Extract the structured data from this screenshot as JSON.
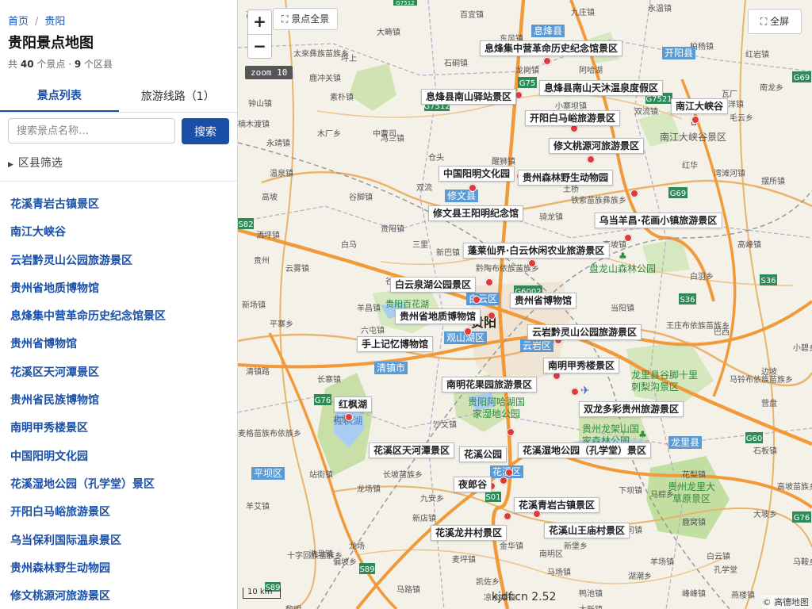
{
  "breadcrumb": {
    "home": "首页",
    "current": "贵阳"
  },
  "title": "贵阳景点地图",
  "stats": {
    "prefix": "共",
    "spot_count": "40",
    "spot_unit": "个景点 ·",
    "district_count": "9",
    "district_unit": "个区县"
  },
  "tabs": [
    {
      "label": "景点列表",
      "active": true
    },
    {
      "label": "旅游线路（1）",
      "active": false
    }
  ],
  "search": {
    "placeholder": "搜索景点名称…",
    "button": "搜索"
  },
  "filter": {
    "arrow": "▶",
    "label": "区县筛选"
  },
  "spots": [
    "花溪青岩古镇景区",
    "南江大峡谷",
    "云岩黔灵山公园旅游景区",
    "贵州省地质博物馆",
    "息烽集中营革命历史纪念馆景区",
    "贵州省博物馆",
    "花溪区天河潭景区",
    "贵州省民族博物馆",
    "南明甲秀楼景区",
    "中国阳明文化园",
    "花溪湿地公园（孔学堂）景区",
    "开阳白马峪旅游景区",
    "乌当保利国际温泉景区",
    "贵州森林野生动物园",
    "修文桃源河旅游景区"
  ],
  "map_controls": {
    "zoom_in": "+",
    "zoom_out": "−",
    "overview_icon": "⛶",
    "overview": "景点全景",
    "fullscreen_icon": "⛶",
    "fullscreen": "全屏",
    "zoom_readout": "zoom 10",
    "scale": "10 km",
    "watermark": "kjdf.cn 2.52",
    "attribution": "© 高德地图"
  },
  "map_callouts": [
    "息烽集中营革命历史纪念馆景区",
    "息烽县南山天沐温泉度假区",
    "息烽县南山驿站景区",
    "南江大峡谷",
    "开阳白马峪旅游景区",
    "修文桃源河旅游景区",
    "中国阳明文化园",
    "贵州森林野生动物园",
    "修文县王阳明纪念馆",
    "乌当羊昌·花画小镇旅游景区",
    "蓬莱仙界·白云休闲农业旅游景区",
    "白云泉湖公园景区",
    "贵州省博物馆",
    "贵州省地质博物馆",
    "云岩黔灵山公园旅游景区",
    "手上记忆博物馆",
    "南明甲秀楼景区",
    "南明花果园旅游景区",
    "双龙多彩贵州旅游景区",
    "红枫湖",
    "花溪区天河潭景区",
    "花溪公园",
    "花溪湿地公园（孔学堂）景区",
    "夜郎谷",
    "花溪青岩古镇景区",
    "花溪龙井村景区",
    "花溪山王庙村景区"
  ],
  "map_district_badges": [
    "息烽县",
    "开阳县",
    "修文县",
    "白云区",
    "观山湖区",
    "云岩区",
    "清镇市",
    "花溪区",
    "龙里县",
    "平坝区"
  ],
  "map_highway_shields": [
    "G75",
    "G7512",
    "G7521",
    "G69",
    "S82",
    "G6002",
    "S36",
    "S36",
    "G76",
    "G60",
    "G76",
    "G69",
    "S01",
    "S89",
    "S89",
    "G7512"
  ],
  "map_city_label": "贵阳",
  "map_green_labels": [
    "南江大峡谷景区",
    "盘龙山森林公园",
    "龙里县谷脚十里刺梨沟景区",
    "贵阳阿哈湖国家湿地公园",
    "贵州龙架山国家森林公园",
    "贵州龙里大草原景区",
    "贵阳百花湖"
  ],
  "map_water_labels": [
    "红枫湖"
  ],
  "map_towns": [
    "大畴镇",
    "太來彝族苗族乡",
    "石硐镇",
    "龙岗镇",
    "九庄镇",
    "永温镇",
    "钟山镇",
    "素朴镇",
    "小寨坝镇",
    "双流镇",
    "西洋镇",
    "南龙乡",
    "毛云乡",
    "楠木渡镇",
    "永靖镇",
    "冯三镇",
    "双流",
    "铁索苗族彝族乡",
    "洒坪镇",
    "谷堡镇",
    "六屯镇",
    "新场镇",
    "王庄布依族苗族乡",
    "沙文镇",
    "麦格苗族布依族乡",
    "长坡苗族乡",
    "羊艾镇",
    "站街镇",
    "龙场镇",
    "新堡乡",
    "十字回族苗族乡",
    "麦坪镇",
    "马场镇",
    "湖潮乡",
    "白云镇",
    "燕楼镇",
    "石板镇",
    "高坡苗族乡",
    "马铃布依族苗族乡",
    "黔陶布依族苗族乡",
    "谷脚镇",
    "醒狮镇",
    "高坡镇",
    "湾滩河镇",
    "云雾镇",
    "摆所镇",
    "洗马镇",
    "羊场镇",
    "鹿窝镇",
    "鸭池镇",
    "凉水井镇",
    "新店镇",
    "马路镇",
    "高峰镇",
    "骑龙镇",
    "当阳镇",
    "白马",
    "清镇路",
    "高坡",
    "三里",
    "大坪镇",
    "旧司镇",
    "营盘",
    "峰峰镇",
    "木厂乡",
    "柏杨镇",
    "鹿冲关镇",
    "高寨乡",
    "红岩镇",
    "中曹司",
    "贵阳镇",
    "阿哈湖",
    "东风镇",
    "瓦厂",
    "百宜镇",
    "温泉镇",
    "偏坡乡",
    "南明区",
    "孔学堂",
    "下坝镇",
    "花梨镇",
    "金华镇",
    "大新镇",
    "羊昌镇",
    "新巴镇",
    "马鞍乡",
    "平寨乡",
    "仓头",
    "坪上",
    "土桥",
    "红华",
    "长寨镇",
    "巴西",
    "小碧乡",
    "贵州",
    "九安乡",
    "黎明",
    "中寨",
    "马棕乡",
    "白羽乡",
    "北京",
    "龙场",
    "凯佐乡",
    "大坡乡",
    "边坡"
  ]
}
